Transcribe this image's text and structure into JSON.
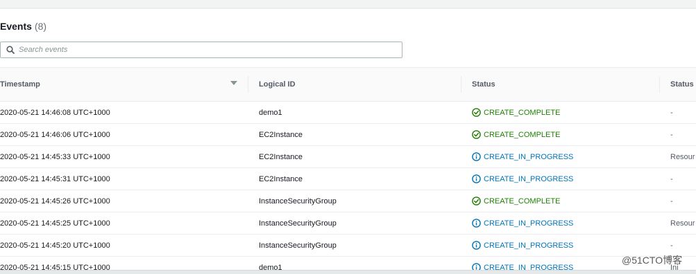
{
  "events_panel": {
    "title": "Events",
    "count": "(8)",
    "search_placeholder": "Search events",
    "columns": {
      "timestamp": "Timestamp",
      "logical_id": "Logical ID",
      "status": "Status",
      "status_reason": "Status"
    },
    "rows": [
      {
        "timestamp": "2020-05-21 14:46:08 UTC+1000",
        "logical_id": "demo1",
        "status": "CREATE_COMPLETE",
        "status_type": "complete",
        "reason": "-"
      },
      {
        "timestamp": "2020-05-21 14:46:06 UTC+1000",
        "logical_id": "EC2Instance",
        "status": "CREATE_COMPLETE",
        "status_type": "complete",
        "reason": "-"
      },
      {
        "timestamp": "2020-05-21 14:45:33 UTC+1000",
        "logical_id": "EC2Instance",
        "status": "CREATE_IN_PROGRESS",
        "status_type": "progress",
        "reason": "Resour"
      },
      {
        "timestamp": "2020-05-21 14:45:31 UTC+1000",
        "logical_id": "EC2Instance",
        "status": "CREATE_IN_PROGRESS",
        "status_type": "progress",
        "reason": "-"
      },
      {
        "timestamp": "2020-05-21 14:45:26 UTC+1000",
        "logical_id": "InstanceSecurityGroup",
        "status": "CREATE_COMPLETE",
        "status_type": "complete",
        "reason": "-"
      },
      {
        "timestamp": "2020-05-21 14:45:25 UTC+1000",
        "logical_id": "InstanceSecurityGroup",
        "status": "CREATE_IN_PROGRESS",
        "status_type": "progress",
        "reason": "Resour"
      },
      {
        "timestamp": "2020-05-21 14:45:20 UTC+1000",
        "logical_id": "InstanceSecurityGroup",
        "status": "CREATE_IN_PROGRESS",
        "status_type": "progress",
        "reason": "-"
      },
      {
        "timestamp": "2020-05-21 14:45:15 UTC+1000",
        "logical_id": "demo1",
        "status": "CREATE_IN_PROGRESS",
        "status_type": "progress",
        "reason": "Ini"
      }
    ]
  },
  "icons": {
    "search": "search-icon",
    "sort": "sort-descending-icon",
    "complete": "check-circle-icon",
    "progress": "info-circle-icon"
  },
  "colors": {
    "complete": "#1d8102",
    "progress": "#0073bb"
  },
  "watermark": "@51CTO博客"
}
